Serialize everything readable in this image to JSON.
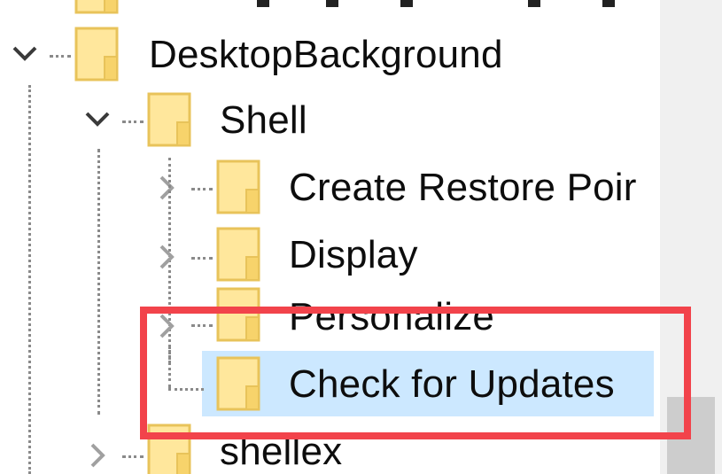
{
  "tree": {
    "items": [
      {
        "label": "",
        "expanded": false
      },
      {
        "label": "DesktopBackground",
        "expanded": true
      },
      {
        "label": "Shell",
        "expanded": true
      },
      {
        "label": "Create Restore Poir",
        "expanded": false
      },
      {
        "label": "Display",
        "expanded": false
      },
      {
        "label": "Personalize",
        "expanded": false
      },
      {
        "label": "Check for Updates",
        "expanded": false,
        "selected": true
      },
      {
        "label": "shellex",
        "expanded": false
      }
    ]
  },
  "colors": {
    "selection": "#cce8ff",
    "highlight": "#f2434b",
    "folder": "#ffe79c",
    "scrollbar_track": "#f0f0f0",
    "scrollbar_thumb": "#cdcdcd"
  }
}
